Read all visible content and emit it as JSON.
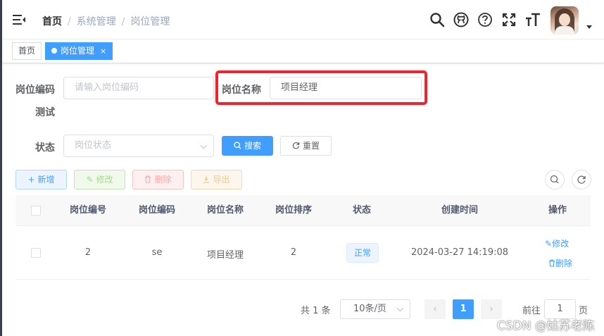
{
  "navbar": {
    "breadcrumb": [
      "首页",
      "系统管理",
      "岗位管理"
    ],
    "icons": [
      "search-icon",
      "github-icon",
      "question-icon",
      "fullscreen-icon",
      "font-size-icon"
    ]
  },
  "tags": [
    {
      "label": "首页"
    },
    {
      "label": "岗位管理",
      "close": "×"
    }
  ],
  "search_form": {
    "post_code": {
      "label": "岗位编码",
      "placeholder": "请输入岗位编码",
      "value": ""
    },
    "post_name": {
      "label": "岗位名称",
      "value": "项目经理"
    },
    "test_label": "测试",
    "status": {
      "label": "状态",
      "placeholder": "岗位状态"
    },
    "search_button": "搜索",
    "reset_button": "重置"
  },
  "toolbar": {
    "add": "新增",
    "edit": "修改",
    "delete": "删除",
    "export": "导出"
  },
  "table": {
    "columns": [
      "岗位编号",
      "岗位编码",
      "岗位名称",
      "岗位排序",
      "状态",
      "创建时间",
      "操作"
    ],
    "rows": [
      {
        "id": "2",
        "code": "se",
        "name": "项目经理",
        "sort": "2",
        "status": "正常",
        "created": "2024-03-27 14:19:08",
        "actions": [
          "修改",
          "删除"
        ]
      }
    ]
  },
  "pagination": {
    "total": "共 1 条",
    "page_size": "10条/页",
    "current_page": "1",
    "goto_prefix": "前往",
    "goto_value": "1",
    "goto_suffix": "页"
  },
  "watermark": "CSDN @姑苏老陈",
  "colors": {
    "primary": "#409eff",
    "highlight_box": "#f5222d",
    "success": "#67c23a",
    "danger": "#f56c6c",
    "warning": "#e6a23c"
  }
}
